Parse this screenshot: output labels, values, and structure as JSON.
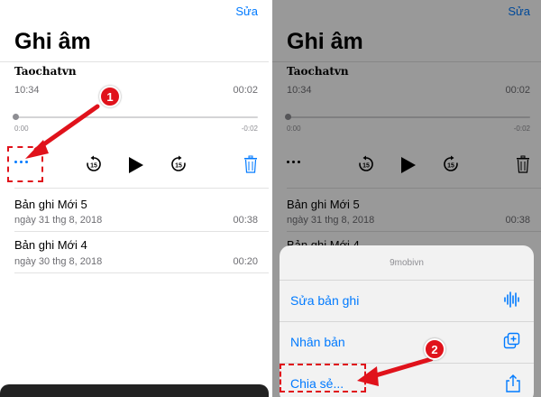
{
  "left_panel": {
    "edit_label": "Sửa",
    "title": "Ghi âm",
    "current_recording": {
      "name": "Taochatvn",
      "time": "10:34",
      "duration": "00:02",
      "scrub_start": "0:00",
      "scrub_end": "-0:02",
      "skip_back_seconds": "15",
      "skip_forward_seconds": "15"
    },
    "recordings": [
      {
        "name": "Bản ghi Mới 5",
        "date": "ngày 31 thg 8, 2018",
        "duration": "00:38"
      },
      {
        "name": "Bản ghi Mới 4",
        "date": "ngày 30 thg 8, 2018",
        "duration": "00:20"
      }
    ],
    "annotation_number": "1"
  },
  "right_panel": {
    "edit_label": "Sửa",
    "title": "Ghi âm",
    "current_recording": {
      "name": "Taochatvn",
      "time": "10:34",
      "duration": "00:02",
      "scrub_start": "0:00",
      "scrub_end": "-0:02",
      "skip_back_seconds": "15",
      "skip_forward_seconds": "15"
    },
    "recordings": [
      {
        "name": "Bản ghi Mới 5",
        "date": "ngày 31 thg 8, 2018",
        "duration": "00:38"
      },
      {
        "name": "Bản ghi Mới 4",
        "date": "",
        "duration": ""
      }
    ],
    "action_sheet": {
      "title": "9mobivn",
      "items": [
        {
          "label": "Sửa bản ghi",
          "icon": "waveform-icon"
        },
        {
          "label": "Nhân bản",
          "icon": "duplicate-icon"
        },
        {
          "label": "Chia sẻ...",
          "icon": "share-icon"
        }
      ]
    },
    "annotation_number": "2"
  },
  "colors": {
    "accent": "#007aff",
    "annotation_red": "#e0121b",
    "secondary_text": "#6d6d72",
    "overlay": "rgba(0,0,0,0.40)"
  }
}
